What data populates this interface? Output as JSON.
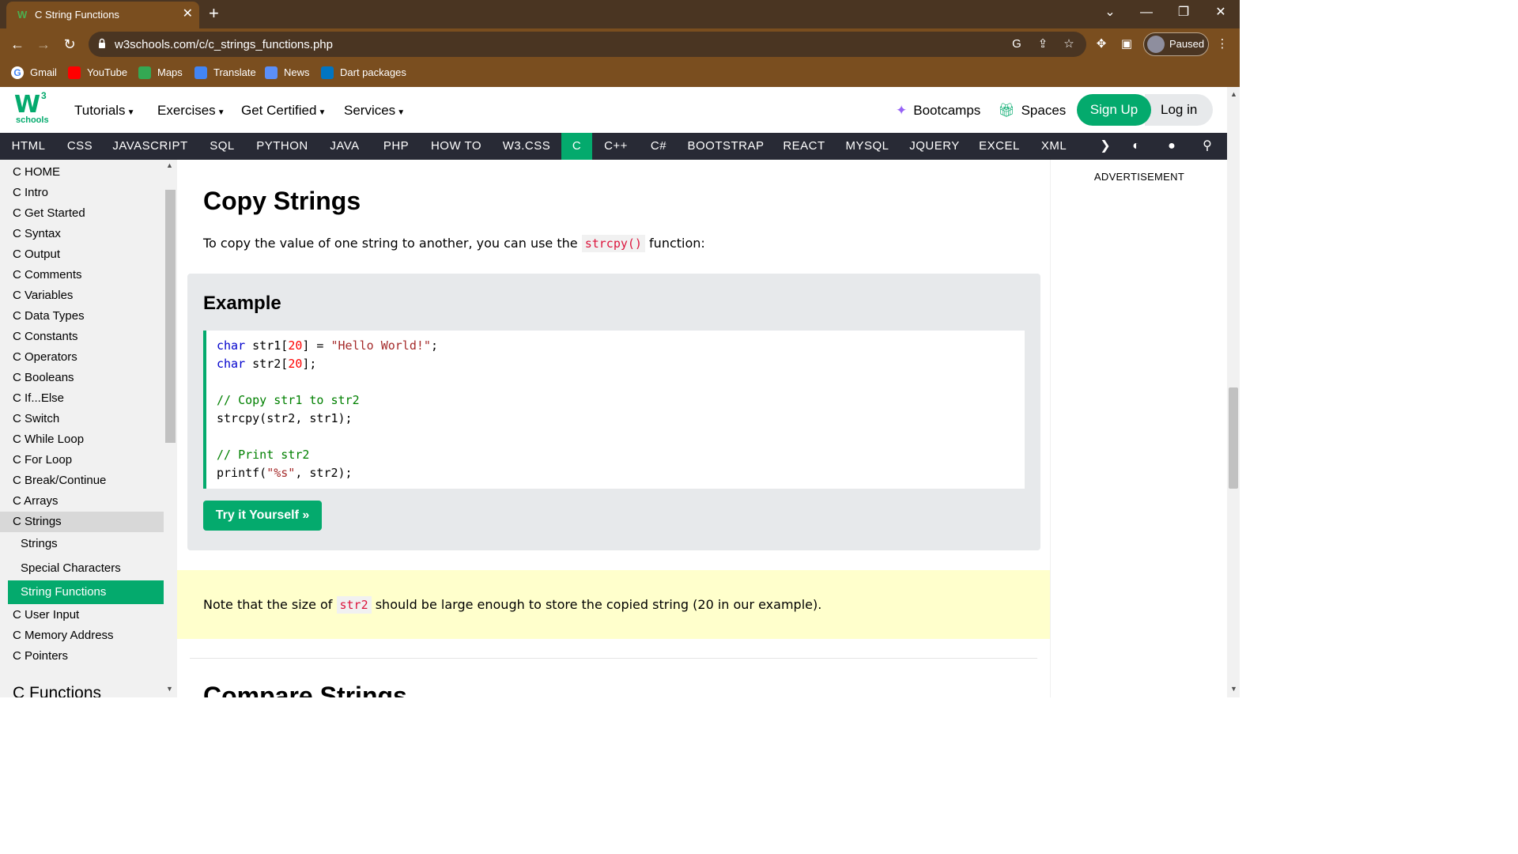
{
  "browser": {
    "tab_title": "C String Functions",
    "tab_close": "✕",
    "new_tab": "+",
    "url": "w3schools.com/c/c_strings_functions.php",
    "profile_label": "Paused",
    "bookmarks": [
      "Gmail",
      "YouTube",
      "Maps",
      "Translate",
      "News",
      "Dart packages"
    ]
  },
  "header": {
    "logo_letter": "W",
    "logo_sup": "3",
    "logo_text": "schools",
    "menus": [
      "Tutorials",
      "Exercises",
      "Get Certified",
      "Services"
    ],
    "bootcamps": "Bootcamps",
    "spaces": "Spaces",
    "signup": "Sign Up",
    "login": "Log in"
  },
  "topics": [
    "HTML",
    "CSS",
    "JAVASCRIPT",
    "SQL",
    "PYTHON",
    "JAVA",
    "PHP",
    "HOW TO",
    "W3.CSS",
    "C",
    "C++",
    "C#",
    "BOOTSTRAP",
    "REACT",
    "MYSQL",
    "JQUERY",
    "EXCEL",
    "XML"
  ],
  "active_topic": "C",
  "sidebar": {
    "items": [
      "C HOME",
      "C Intro",
      "C Get Started",
      "C Syntax",
      "C Output",
      "C Comments",
      "C Variables",
      "C Data Types",
      "C Constants",
      "C Operators",
      "C Booleans",
      "C If...Else",
      "C Switch",
      "C While Loop",
      "C For Loop",
      "C Break/Continue",
      "C Arrays",
      "C Strings"
    ],
    "sub_items": [
      "Strings",
      "Special Characters",
      "String Functions"
    ],
    "after_items": [
      "C User Input",
      "C Memory Address",
      "C Pointers"
    ],
    "next_section": "C Functions"
  },
  "main": {
    "heading": "Copy Strings",
    "intro_before": "To copy the value of one string to another, you can use the ",
    "intro_code": "strcpy()",
    "intro_after": " function:",
    "example_title": "Example",
    "code": {
      "l1_kw": "char",
      "l1_a": " str1[",
      "l1_num": "20",
      "l1_b": "] = ",
      "l1_str": "\"Hello World!\"",
      "l1_c": ";",
      "l2_kw": "char",
      "l2_a": " str2[",
      "l2_num": "20",
      "l2_b": "];",
      "l3_cmt": "// Copy str1 to str2",
      "l4": "strcpy(str2, str1);",
      "l5_cmt": "// Print str2",
      "l6_a": "printf(",
      "l6_str": "\"%s\"",
      "l6_b": ", str2);"
    },
    "try_button": "Try it Yourself »",
    "note_before": "Note that the size of ",
    "note_code": "str2",
    "note_after": " should be large enough to store the copied string (20 in our example).",
    "next_heading": "Compare Strings"
  },
  "ad": {
    "label": "ADVERTISEMENT"
  },
  "colors": {
    "brand_green": "#04aa6d",
    "topnav_bg": "#282a35",
    "note_bg": "#ffffcc",
    "example_bg": "#e7e9eb",
    "chrome_dark": "#4a3522",
    "chrome_mid": "#7a4e1f"
  }
}
